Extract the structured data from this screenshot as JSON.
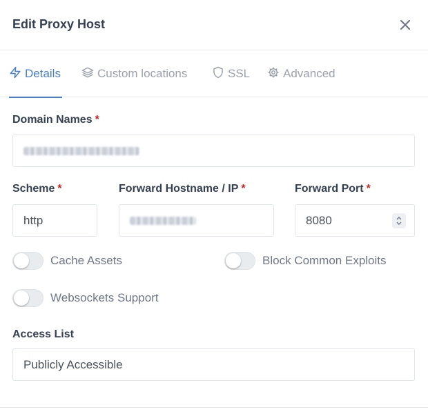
{
  "modal": {
    "title": "Edit Proxy Host",
    "close_icon": "close-icon"
  },
  "tabs": [
    {
      "label": "Details",
      "icon": "bolt-icon",
      "active": true
    },
    {
      "label": "Custom locations",
      "icon": "layers-icon",
      "active": false
    },
    {
      "label": "SSL",
      "icon": "shield-icon",
      "active": false
    },
    {
      "label": "Advanced",
      "icon": "gear-icon",
      "active": false
    }
  ],
  "form": {
    "domain_names": {
      "label": "Domain Names",
      "required_mark": "*"
    },
    "scheme": {
      "label": "Scheme",
      "required_mark": "*",
      "value": "http"
    },
    "forward_hostname": {
      "label": "Forward Hostname / IP",
      "required_mark": "*"
    },
    "forward_port": {
      "label": "Forward Port",
      "required_mark": "*",
      "value": "8080"
    },
    "toggles": {
      "cache_assets": {
        "label": "Cache Assets",
        "on": false
      },
      "block_common_exploits": {
        "label": "Block Common Exploits",
        "on": false
      },
      "websockets_support": {
        "label": "Websockets Support",
        "on": false
      }
    },
    "access_list": {
      "label": "Access List",
      "value": "Publicly Accessible"
    }
  },
  "colors": {
    "accent": "#467fcf",
    "required": "#cd201f",
    "text": "#354052",
    "muted": "#9aa0ac"
  }
}
